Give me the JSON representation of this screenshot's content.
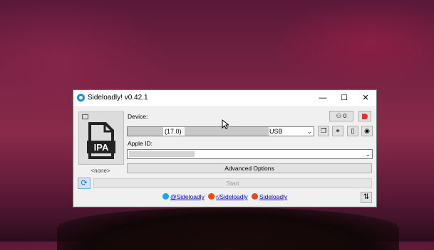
{
  "window": {
    "title": "Sideloadly! v0.42.1",
    "minimize": "—",
    "maximize": "☐",
    "close": "✕"
  },
  "ipa": {
    "icon_text": "IPA",
    "none_label": "<none>"
  },
  "device": {
    "label": "Device:",
    "value_version": "(17.0)",
    "value_conn": "USB",
    "badge_count": "0"
  },
  "apple_id": {
    "label": "Apple ID:"
  },
  "buttons": {
    "advanced": "Advanced Options",
    "start": "Start",
    "sort": "⇅"
  },
  "links": {
    "twitter": "@Sideloadly",
    "reddit": "r/Sideloadly",
    "site": "Sideloadly"
  },
  "colors": {
    "twitter": "#1da1f2",
    "reddit": "#ff4500",
    "site": "#e8452c",
    "accent": "#1e8fd4"
  }
}
